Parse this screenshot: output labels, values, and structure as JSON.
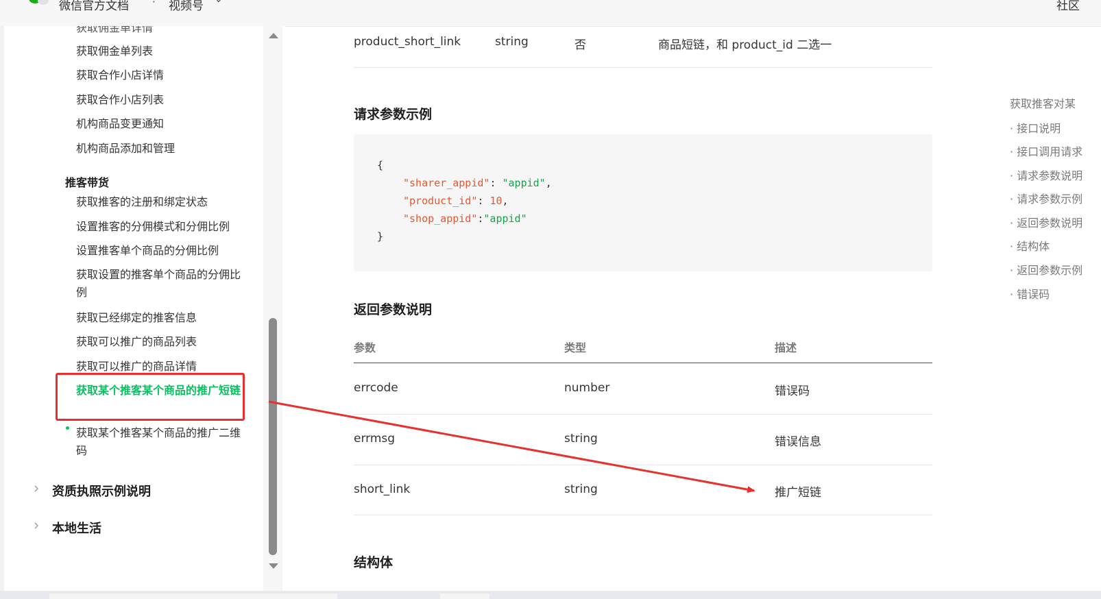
{
  "topbar": {
    "breadcrumb_1": "微信官方文档",
    "separator": "·",
    "breadcrumb_2": "视频号",
    "community_link": "社区"
  },
  "sidebar": {
    "items_top": [
      "获取佣金单详情",
      "获取佣金单列表",
      "获取合作小店详情",
      "获取合作小店列表",
      "机构商品变更通知",
      "机构商品添加和管理"
    ],
    "group_title": "推客带货",
    "group_items": [
      "获取推客的注册和绑定状态",
      "设置推客的分佣模式和分佣比例",
      "设置推客单个商品的分佣比例",
      "获取设置的推客单个商品的分佣比例",
      "获取已经绑定的推客信息",
      "获取可以推广的商品列表",
      "获取可以推广的商品详情",
      "获取某个推客某个商品的推广短链",
      "获取某个推客某个商品的推广二维码"
    ],
    "categories": [
      "资质执照示例说明",
      "本地生活"
    ]
  },
  "content": {
    "param_row": {
      "name": "product_short_link",
      "type": "string",
      "required": "否",
      "desc": "商品短链，和 product_id 二选一"
    },
    "request_example_title": "请求参数示例",
    "code": {
      "open": "{",
      "key1": "\"sharer_appid\"",
      "val1": "\"appid\"",
      "key2": "\"product_id\"",
      "val2": "10",
      "key3": "\"shop_appid\"",
      "val3": "\"appid\"",
      "close": "}"
    },
    "response_title": "返回参数说明",
    "response_table": {
      "headers": [
        "参数",
        "类型",
        "描述"
      ],
      "rows": [
        {
          "name": "errcode",
          "type": "number",
          "desc": "错误码"
        },
        {
          "name": "errmsg",
          "type": "string",
          "desc": "错误信息"
        },
        {
          "name": "short_link",
          "type": "string",
          "desc": "推广短链"
        }
      ]
    },
    "struct_title": "结构体"
  },
  "toc": {
    "heading": "获取推客对某",
    "items": [
      "接口说明",
      "接口调用请求",
      "请求参数说明",
      "请求参数示例",
      "返回参数说明",
      "结构体",
      "返回参数示例",
      "错误码"
    ]
  },
  "annotation": {
    "highlight_color": "#e8302e",
    "accent_color": "#07c160"
  }
}
